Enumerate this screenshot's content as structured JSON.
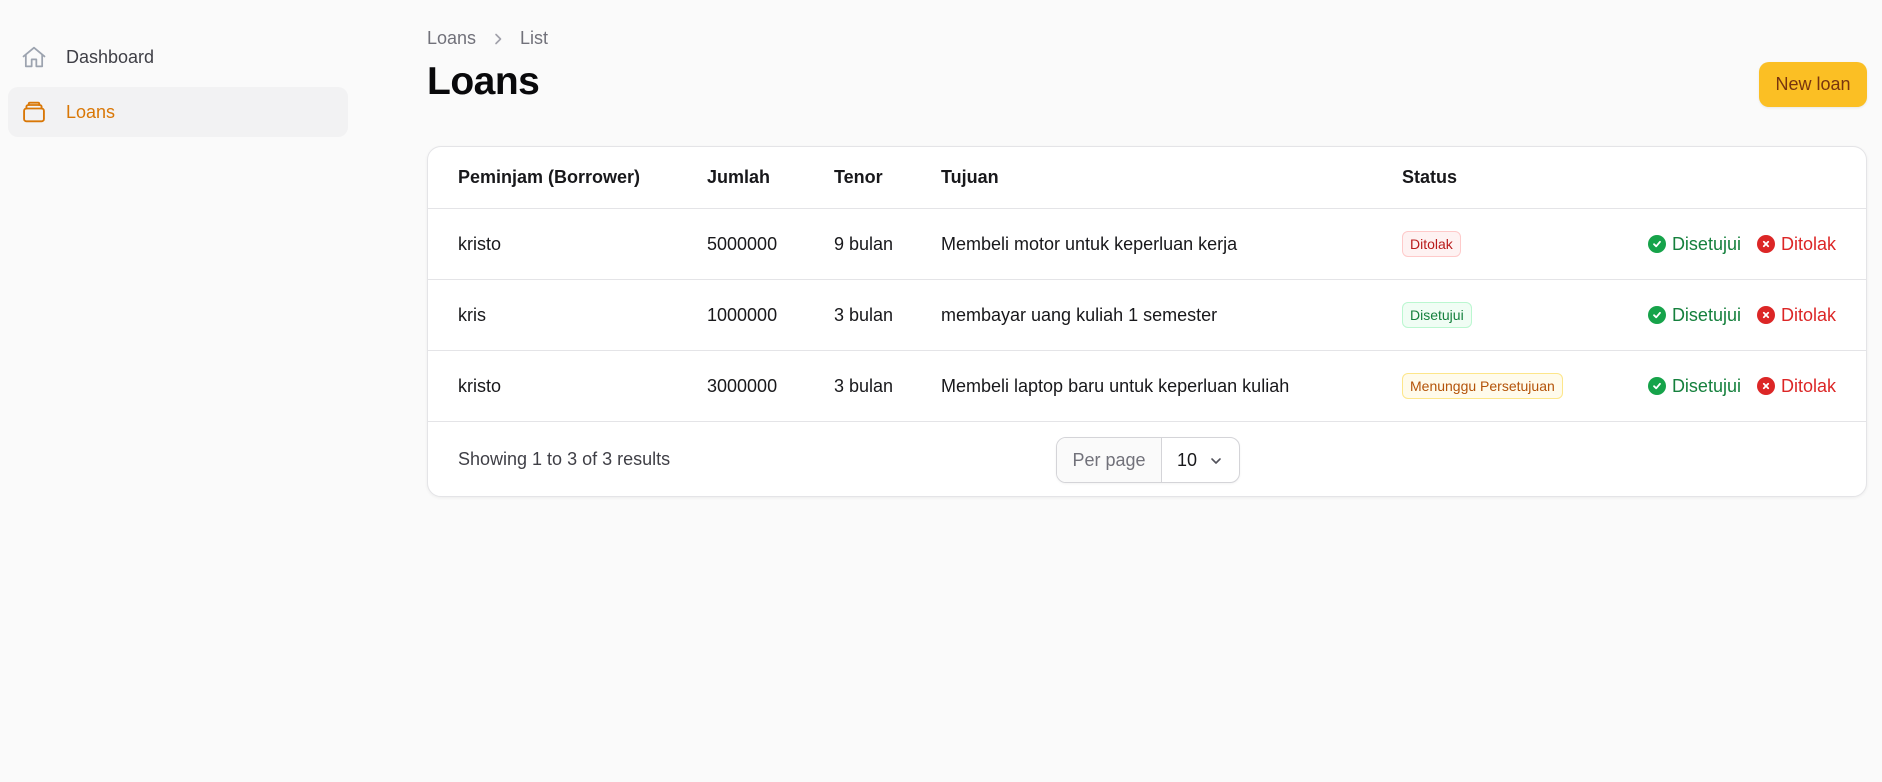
{
  "sidebar": {
    "items": [
      {
        "label": "Dashboard",
        "icon": "home-icon"
      },
      {
        "label": "Loans",
        "icon": "loans-icon"
      }
    ]
  },
  "breadcrumb": {
    "parent": "Loans",
    "current": "List"
  },
  "page": {
    "title": "Loans",
    "new_button": "New loan"
  },
  "table": {
    "headers": {
      "borrower": "Peminjam (Borrower)",
      "amount": "Jumlah",
      "tenor": "Tenor",
      "purpose": "Tujuan",
      "status": "Status"
    },
    "rows": [
      {
        "borrower": "kristo",
        "amount": "5000000",
        "tenor": "9 bulan",
        "purpose": "Membeli motor untuk keperluan kerja",
        "status": "Ditolak",
        "approve": "Disetujui",
        "reject": "Ditolak"
      },
      {
        "borrower": "kris",
        "amount": "1000000",
        "tenor": "3 bulan",
        "purpose": "membayar uang kuliah 1 semester",
        "status": "Disetujui",
        "approve": "Disetujui",
        "reject": "Ditolak"
      },
      {
        "borrower": "kristo",
        "amount": "3000000",
        "tenor": "3 bulan",
        "purpose": "Membeli laptop baru untuk keperluan kuliah",
        "status": "Menunggu Persetujuan",
        "approve": "Disetujui",
        "reject": "Ditolak"
      }
    ]
  },
  "footer": {
    "summary": "Showing 1 to 3 of 3 results",
    "per_page_label": "Per page",
    "per_page_value": "10"
  },
  "colors": {
    "accent": "#d97706",
    "primary_button": "#fbbf24",
    "approve": "#15803d",
    "reject": "#dc2626"
  }
}
